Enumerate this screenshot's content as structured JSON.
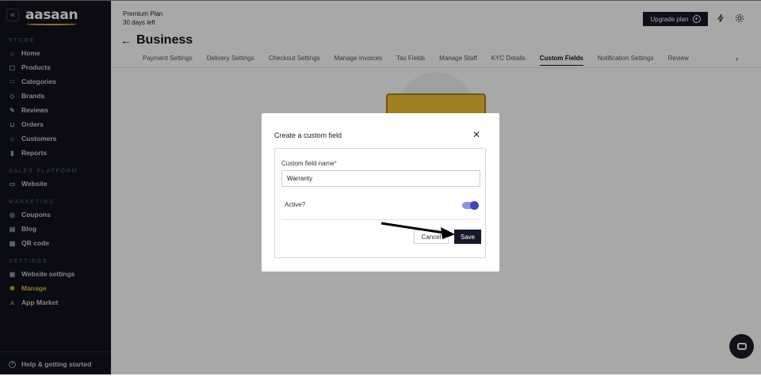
{
  "sidebar": {
    "collapse_glyph": "«",
    "logo": "aasaan",
    "sections": [
      {
        "title": "STORE",
        "items": [
          {
            "label": "Home",
            "icon": "home-icon"
          },
          {
            "label": "Products",
            "icon": "products-icon"
          },
          {
            "label": "Categories",
            "icon": "categories-icon"
          },
          {
            "label": "Brands",
            "icon": "tag-icon"
          },
          {
            "label": "Reviews",
            "icon": "reviews-icon"
          },
          {
            "label": "Orders",
            "icon": "cart-icon"
          },
          {
            "label": "Customers",
            "icon": "users-icon"
          },
          {
            "label": "Reports",
            "icon": "bar-chart-icon"
          }
        ]
      },
      {
        "title": "SALES PLATFORM",
        "items": [
          {
            "label": "Website",
            "icon": "monitor-icon"
          }
        ]
      },
      {
        "title": "MARKETING",
        "items": [
          {
            "label": "Coupons",
            "icon": "coupon-icon"
          },
          {
            "label": "Blog",
            "icon": "blog-icon"
          },
          {
            "label": "QR code",
            "icon": "qr-icon"
          }
        ]
      },
      {
        "title": "SETTINGS",
        "items": [
          {
            "label": "Website settings",
            "icon": "website-settings-icon"
          },
          {
            "label": "Manage",
            "icon": "gear-icon",
            "active": true
          },
          {
            "label": "App Market",
            "icon": "app-market-icon"
          }
        ]
      }
    ],
    "help_label": "Help & getting started"
  },
  "header": {
    "plan_name": "Premium Plan",
    "plan_days": "30 days left",
    "upgrade_label": "Upgrade plan",
    "back_glyph": "←",
    "page_title": "Business"
  },
  "tabs": [
    {
      "label": "Payment Settings"
    },
    {
      "label": "Delivery Settings"
    },
    {
      "label": "Checkout Settings"
    },
    {
      "label": "Manage Invoices"
    },
    {
      "label": "Tax Fields"
    },
    {
      "label": "Manage Staff"
    },
    {
      "label": "KYC Details"
    },
    {
      "label": "Custom Fields",
      "active": true
    },
    {
      "label": "Notification Settings"
    },
    {
      "label": "Review"
    }
  ],
  "modal": {
    "title": "Create a custom field",
    "close_glyph": "✕",
    "field_label": "Custom field name",
    "required_mark": "*",
    "field_value": "Warranty",
    "active_label": "Active?",
    "active_value": true,
    "cancel_label": "Cancel",
    "save_label": "Save"
  },
  "colors": {
    "sidebar_bg": "#11131d",
    "accent_active": "#e2b33c",
    "primary_button": "#15172a",
    "toggle_on": "#3c46c4"
  }
}
